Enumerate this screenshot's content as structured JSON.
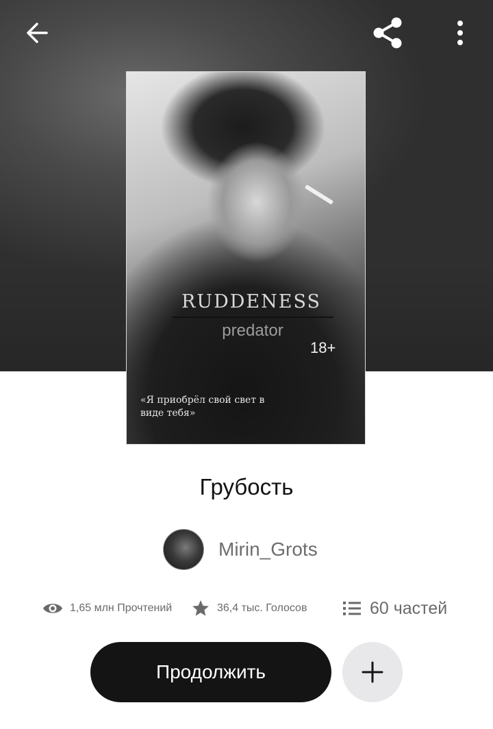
{
  "toolbar": {
    "back_icon": "arrow-left-icon",
    "share_icon": "share-icon",
    "more_icon": "more-vertical-icon"
  },
  "cover": {
    "title": "RUDDENESS",
    "subtitle": "predator",
    "age_rating": "18+",
    "quote": "«Я приобрёл свой свет в виде тебя»"
  },
  "story": {
    "title": "Грубость",
    "author": "Mirin_Grots"
  },
  "stats": {
    "reads": "1,65 млн Прочтений",
    "votes": "36,4 тыс. Голосов",
    "parts": "60 частей"
  },
  "actions": {
    "continue_label": "Продолжить",
    "add_icon": "plus-icon"
  },
  "colors": {
    "primary_button": "#141414",
    "secondary_button": "#e8e8ea",
    "muted_text": "#6a6a6a"
  }
}
